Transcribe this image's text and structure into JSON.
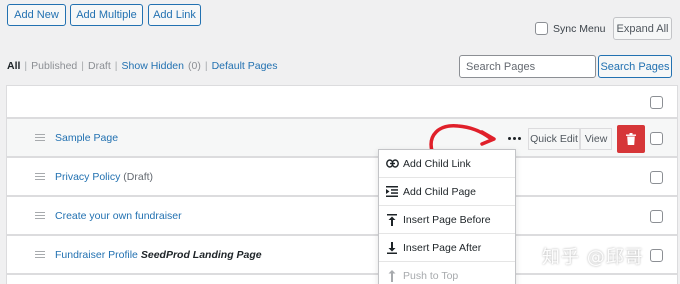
{
  "toolbar": {
    "add_new": "Add New",
    "add_multiple": "Add Multiple",
    "add_link": "Add Link",
    "sync_menu": "Sync Menu",
    "expand_all": "Expand All"
  },
  "filters": {
    "all": "All",
    "published": "Published",
    "draft": "Draft",
    "show_hidden": "Show Hidden",
    "hidden_count": "(0)",
    "default_pages": "Default Pages",
    "separator": "|"
  },
  "search": {
    "placeholder": "Search Pages",
    "button": "Search Pages"
  },
  "rows": [
    {
      "title": "Sample Page",
      "state": "",
      "template": ""
    },
    {
      "title": "Privacy Policy",
      "state": "(Draft)",
      "template": ""
    },
    {
      "title": "Create your own fundraiser",
      "state": "",
      "template": ""
    },
    {
      "title": "Fundraiser Profile",
      "state": "",
      "template": "SeedProd Landing Page"
    }
  ],
  "row_actions": {
    "quick_edit": "Quick Edit",
    "view": "View"
  },
  "dropdown": {
    "items": [
      {
        "label": "Add Child Link",
        "icon": "link-icon"
      },
      {
        "label": "Add Child Page",
        "icon": "indent-icon"
      },
      {
        "label": "Insert Page Before",
        "icon": "insert-before-icon"
      },
      {
        "label": "Insert Page After",
        "icon": "insert-after-icon"
      },
      {
        "label": "Push to Top",
        "icon": "push-top-icon"
      }
    ]
  },
  "colors": {
    "accent": "#2271b1",
    "danger": "#d63638",
    "arrow": "#e0202a"
  },
  "watermark": "知乎 @邱哥"
}
